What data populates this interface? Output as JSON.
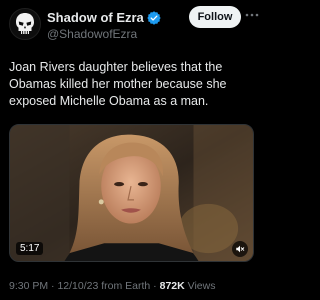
{
  "author": {
    "display_name": "Shadow of Ezra",
    "handle": "@ShadowofEzra",
    "verified": true,
    "avatar_icon": "punisher-skull-icon"
  },
  "header": {
    "follow_label": "Follow",
    "more_icon": "more-horizontal-icon"
  },
  "tweet": {
    "text": "Joan Rivers daughter believes that the Obamas killed her mother because she exposed Michelle Obama as a man."
  },
  "media": {
    "type": "video",
    "duration": "5:17",
    "volume_icon": "speaker-muted-icon"
  },
  "meta": {
    "time": "9:30 PM",
    "date": "12/10/23",
    "source": "from Earth",
    "views_count": "872K",
    "views_label": "Views",
    "separator": " · "
  },
  "colors": {
    "background": "#000000",
    "text_primary": "#e7e9ea",
    "text_secondary": "#71767b",
    "verified_blue": "#1d9bf0",
    "follow_bg": "#eff3f4"
  }
}
